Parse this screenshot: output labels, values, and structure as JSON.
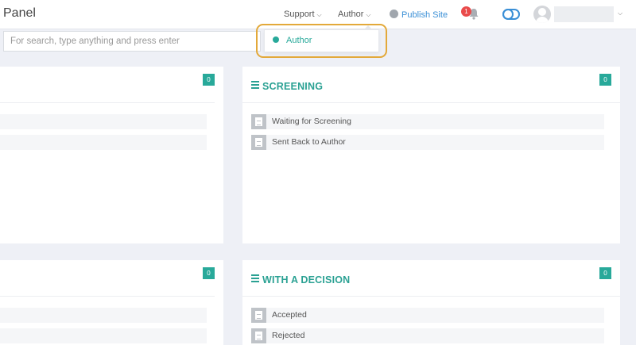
{
  "header": {
    "brand": "Panel",
    "nav": {
      "support": "Support",
      "author": "Author",
      "publish": "Publish Site"
    },
    "notifications_count": "1"
  },
  "search": {
    "placeholder": "For search, type anything and press enter"
  },
  "author_menu": {
    "items": [
      "Author"
    ]
  },
  "panels": {
    "left_top": {
      "count": "0"
    },
    "screening": {
      "title": "SCREENING",
      "count": "0",
      "items": [
        "Waiting for Screening",
        "Sent Back to Author"
      ]
    },
    "left_bottom": {
      "count": "0"
    },
    "decision": {
      "title": "WITH A DECISION",
      "count": "0",
      "items": [
        "Accepted",
        "Rejected"
      ]
    }
  },
  "colors": {
    "accent": "#28a99a",
    "link": "#3a8fd6",
    "badge": "#e94b4b",
    "highlight": "#e3a93a"
  }
}
